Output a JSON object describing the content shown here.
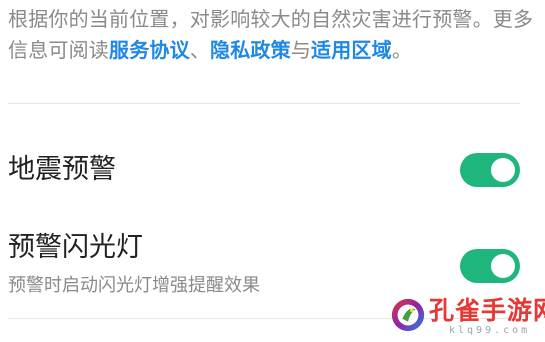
{
  "description": {
    "text_1": "根据你的当前位置，对影响较大的自然灾害进行预警。更多信息可阅读",
    "link_service": "服务协议",
    "sep_1": "、",
    "link_privacy": "隐私政策",
    "sep_2": "与",
    "link_area": "适用区域",
    "end": "。"
  },
  "settings": {
    "earthquake_alert": {
      "title": "地震预警",
      "enabled": true
    },
    "alert_flashlight": {
      "title": "预警闪光灯",
      "subtitle": "预警时启动闪光灯增强提醒效果",
      "enabled": true
    }
  },
  "colors": {
    "toggle_on": "#1fb67e",
    "link": "#1e88e5",
    "watermark": "#e53935"
  },
  "watermark": {
    "text": "孔雀手游网",
    "url": "klq99.com"
  }
}
